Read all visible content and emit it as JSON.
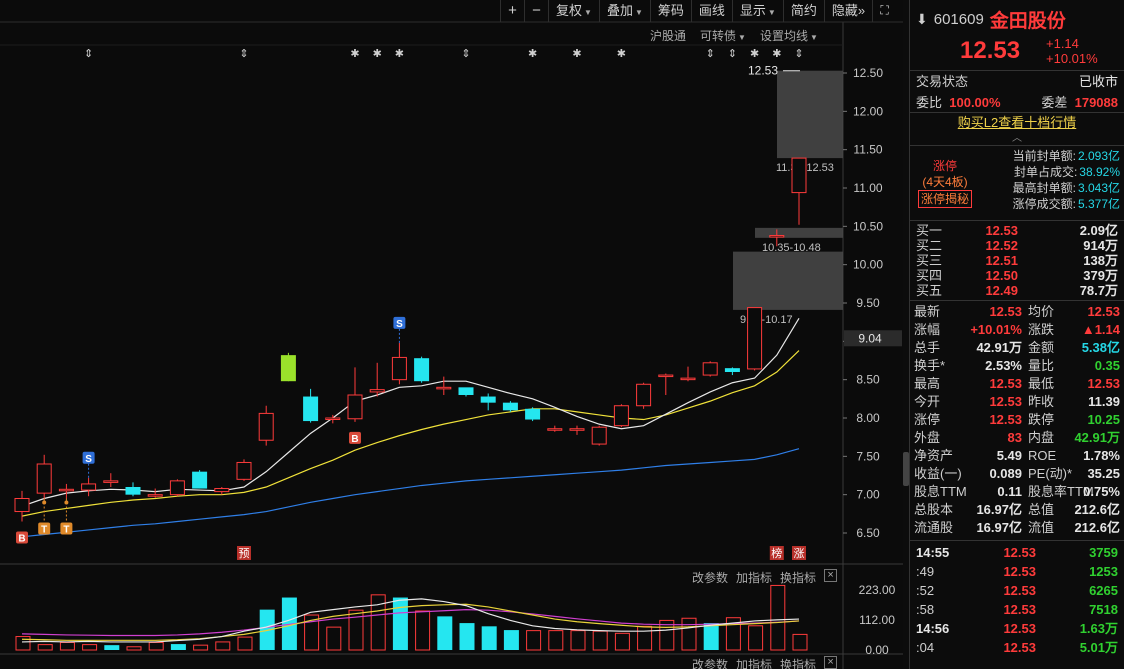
{
  "toolbar": {
    "plus": "+",
    "minus": "−",
    "items": [
      {
        "label": "复权",
        "caret": true
      },
      {
        "label": "叠加",
        "caret": true
      },
      {
        "label": "筹码",
        "caret": false
      },
      {
        "label": "画线",
        "caret": false
      },
      {
        "label": "显示",
        "caret": true
      },
      {
        "label": "简约",
        "caret": false
      },
      {
        "label": "隐藏",
        "caret": false
      }
    ],
    "hide_arrows": "»"
  },
  "subbar": {
    "hgt": "沪股通",
    "convertible": "可转债",
    "ma_setting": "设置均线"
  },
  "colors": {
    "up": "#ff3b3b",
    "down": "#25e6f0",
    "ma5": "#e8e8e8",
    "ma10": "#f0e23a",
    "ma30": "#2f7fe8",
    "vol_ma5": "#e8e8e8",
    "vol_ma10": "#e8d23a",
    "vol_ma20": "#d040d0"
  },
  "chart_data": {
    "type": "candlestick",
    "ylim": [
      6.3,
      12.75
    ],
    "y_ticks": [
      "12.50",
      "12.00",
      "11.50",
      "11.00",
      "10.50",
      "10.00",
      "9.50",
      "9.00",
      "8.50",
      "8.00",
      "7.50",
      "7.00",
      "6.50"
    ],
    "current_price_label": "9.04",
    "last_price_marker": "12.53",
    "candles": [
      {
        "o": 6.78,
        "h": 7.05,
        "l": 6.65,
        "c": 6.95
      },
      {
        "o": 7.02,
        "h": 7.52,
        "l": 6.95,
        "c": 7.4
      },
      {
        "o": 7.06,
        "h": 7.14,
        "l": 6.95,
        "c": 7.07
      },
      {
        "o": 7.06,
        "h": 7.22,
        "l": 6.98,
        "c": 7.14
      },
      {
        "o": 7.16,
        "h": 7.28,
        "l": 7.1,
        "c": 7.18
      },
      {
        "o": 7.1,
        "h": 7.16,
        "l": 6.98,
        "c": 7.0
      },
      {
        "o": 6.98,
        "h": 7.08,
        "l": 6.96,
        "c": 7.0
      },
      {
        "o": 7.0,
        "h": 7.2,
        "l": 6.98,
        "c": 7.18
      },
      {
        "o": 7.3,
        "h": 7.32,
        "l": 7.08,
        "c": 7.08
      },
      {
        "o": 7.04,
        "h": 7.1,
        "l": 7.0,
        "c": 7.08
      },
      {
        "o": 7.2,
        "h": 7.46,
        "l": 7.18,
        "c": 7.42
      },
      {
        "o": 7.71,
        "h": 8.16,
        "l": 7.64,
        "c": 8.06
      },
      {
        "o": 8.82,
        "h": 8.85,
        "l": 8.48,
        "c": 8.48
      },
      {
        "o": 8.28,
        "h": 8.38,
        "l": 7.94,
        "c": 7.96
      },
      {
        "o": 8.0,
        "h": 8.04,
        "l": 7.93,
        "c": 8.0
      },
      {
        "o": 7.99,
        "h": 8.66,
        "l": 7.95,
        "c": 8.3
      },
      {
        "o": 8.34,
        "h": 8.72,
        "l": 8.28,
        "c": 8.37
      },
      {
        "o": 8.5,
        "h": 8.98,
        "l": 8.44,
        "c": 8.79
      },
      {
        "o": 8.78,
        "h": 8.8,
        "l": 8.46,
        "c": 8.48
      },
      {
        "o": 8.38,
        "h": 8.54,
        "l": 8.3,
        "c": 8.4
      },
      {
        "o": 8.4,
        "h": 8.38,
        "l": 8.28,
        "c": 8.3
      },
      {
        "o": 8.28,
        "h": 8.32,
        "l": 8.1,
        "c": 8.2
      },
      {
        "o": 8.2,
        "h": 8.22,
        "l": 8.08,
        "c": 8.1
      },
      {
        "o": 8.12,
        "h": 8.14,
        "l": 7.96,
        "c": 7.98
      },
      {
        "o": 7.86,
        "h": 7.9,
        "l": 7.82,
        "c": 7.86
      },
      {
        "o": 7.84,
        "h": 7.9,
        "l": 7.78,
        "c": 7.86
      },
      {
        "o": 7.66,
        "h": 7.9,
        "l": 7.64,
        "c": 7.88
      },
      {
        "o": 7.9,
        "h": 8.18,
        "l": 7.88,
        "c": 8.16
      },
      {
        "o": 8.16,
        "h": 8.46,
        "l": 8.12,
        "c": 8.44
      },
      {
        "o": 8.56,
        "h": 8.58,
        "l": 8.3,
        "c": 8.56
      },
      {
        "o": 8.52,
        "h": 8.67,
        "l": 8.48,
        "c": 8.52
      },
      {
        "o": 8.56,
        "h": 8.74,
        "l": 8.54,
        "c": 8.72
      },
      {
        "o": 8.65,
        "h": 8.66,
        "l": 8.56,
        "c": 8.6
      },
      {
        "o": 8.64,
        "h": 9.44,
        "l": 8.62,
        "c": 9.44
      },
      {
        "o": 10.38,
        "h": 10.46,
        "l": 10.24,
        "c": 10.38
      },
      {
        "o": 10.94,
        "h": 11.39,
        "l": 10.52,
        "c": 11.39
      }
    ],
    "ma5": [
      6.85,
      6.95,
      7.02,
      7.05,
      7.07,
      7.06,
      7.04,
      7.07,
      7.06,
      7.05,
      7.1,
      7.3,
      7.55,
      7.8,
      8.0,
      8.22,
      8.3,
      8.4,
      8.42,
      8.48,
      8.48,
      8.4,
      8.32,
      8.25,
      8.14,
      8.02,
      7.92,
      7.86,
      7.9,
      8.05,
      8.2,
      8.34,
      8.46,
      8.52,
      8.82,
      9.3
    ],
    "ma10": [
      6.72,
      6.78,
      6.82,
      6.86,
      6.9,
      6.93,
      6.95,
      6.98,
      7.0,
      7.0,
      7.03,
      7.1,
      7.22,
      7.34,
      7.45,
      7.58,
      7.68,
      7.77,
      7.85,
      7.92,
      7.98,
      8.04,
      8.08,
      8.12,
      8.12,
      8.08,
      8.04,
      8.0,
      7.98,
      8.04,
      8.13,
      8.22,
      8.33,
      8.42,
      8.6,
      8.88
    ],
    "ma30": [
      6.45,
      6.48,
      6.51,
      6.54,
      6.57,
      6.6,
      6.62,
      6.65,
      6.68,
      6.71,
      6.74,
      6.78,
      6.84,
      6.9,
      6.95,
      7.0,
      7.04,
      7.08,
      7.12,
      7.15,
      7.18,
      7.2,
      7.22,
      7.24,
      7.26,
      7.28,
      7.3,
      7.32,
      7.35,
      7.38,
      7.4,
      7.42,
      7.44,
      7.46,
      7.52,
      7.6
    ],
    "chip_ranges": [
      {
        "from": 11.39,
        "to": 12.53,
        "label": "11.39-12.53"
      },
      {
        "from": 10.35,
        "to": 10.48,
        "label": "10.35-10.48"
      },
      {
        "from": 9.41,
        "to": 10.17,
        "label": "9.41-10.17"
      }
    ],
    "markers": [
      {
        "index": 0,
        "text": "B",
        "kind": "buy"
      },
      {
        "index": 1,
        "text": "T",
        "kind": "t"
      },
      {
        "index": 2,
        "text": "T",
        "kind": "t"
      },
      {
        "index": 3,
        "text": "S",
        "kind": "sell"
      },
      {
        "index": 15,
        "text": "B",
        "kind": "buy"
      },
      {
        "index": 17,
        "text": "S",
        "kind": "sell"
      }
    ],
    "bottom_tags": [
      {
        "index": 10,
        "text": "预"
      },
      {
        "index": 34,
        "text": "榜"
      },
      {
        "index": 35,
        "text": "涨"
      }
    ],
    "event_stars": [
      {
        "index": 3,
        "symbol": "⇕"
      },
      {
        "index": 10,
        "symbol": "⇕"
      },
      {
        "index": 15,
        "symbol": "✱"
      },
      {
        "index": 16,
        "symbol": "✱"
      },
      {
        "index": 17,
        "symbol": "✱"
      },
      {
        "index": 20,
        "symbol": "⇕"
      },
      {
        "index": 23,
        "symbol": "✱"
      },
      {
        "index": 25,
        "symbol": "✱"
      },
      {
        "index": 27,
        "symbol": "✱"
      },
      {
        "index": 31,
        "symbol": "⇕"
      },
      {
        "index": 32,
        "symbol": "⇕"
      },
      {
        "index": 33,
        "symbol": "✱"
      },
      {
        "index": 34,
        "symbol": "✱"
      },
      {
        "index": 35,
        "symbol": "⇕"
      }
    ],
    "volume": {
      "y_ticks": [
        "223.00",
        "112.00",
        "0.00"
      ],
      "ylim": [
        0,
        223
      ],
      "values": [
        18,
        50,
        20,
        28,
        20,
        18,
        12,
        28,
        22,
        18,
        30,
        48,
        150,
        195,
        130,
        85,
        148,
        205,
        195,
        145,
        125,
        100,
        88,
        74,
        72,
        72,
        72,
        70,
        62,
        88,
        110,
        118,
        100,
        120,
        90,
        240,
        58
      ],
      "ma5": [
        30,
        32,
        30,
        32,
        30,
        30,
        30,
        35,
        40,
        50,
        70,
        85,
        110,
        140,
        150,
        160,
        168,
        185,
        190,
        180,
        165,
        135,
        110,
        90,
        80,
        75,
        72,
        70,
        70,
        74,
        82,
        92,
        100,
        108,
        112,
        115
      ],
      "ma10": [
        40,
        38,
        36,
        36,
        36,
        36,
        36,
        38,
        42,
        50,
        58,
        72,
        90,
        110,
        125,
        135,
        145,
        158,
        165,
        168,
        170,
        160,
        145,
        130,
        115,
        105,
        98,
        92,
        86,
        84,
        86,
        90,
        94,
        98,
        102,
        108
      ],
      "ma20": [
        60,
        58,
        56,
        55,
        54,
        54,
        54,
        56,
        60,
        66,
        74,
        84,
        95,
        105,
        115,
        122,
        130,
        138,
        142,
        146,
        150,
        148,
        142,
        134,
        125,
        116,
        108,
        100,
        96,
        94,
        94,
        96,
        98,
        100,
        103,
        108
      ]
    }
  },
  "vol_tools": {
    "param": "改参数",
    "add": "加指标",
    "swap": "换指标",
    "close": "×"
  },
  "panel": {
    "code": "601609",
    "name": "金田股份",
    "price": "12.53",
    "change": "+1.14",
    "change_pct": "+10.01%",
    "status_label": "交易状态",
    "status_value": "已收市",
    "wb_label": "委比",
    "wb_value": "100.00%",
    "wc_label": "委差",
    "wc_value": "179088",
    "l2_link": "购买L2查看十档行情",
    "limit": {
      "tag": "涨停",
      "days": "(4天4板)",
      "secret": "涨停揭秘",
      "rows": [
        {
          "k": "当前封单额:",
          "v": "2.093亿"
        },
        {
          "k": "封单占成交:",
          "v": "38.92%"
        },
        {
          "k": "最高封单额:",
          "v": "3.043亿"
        },
        {
          "k": "涨停成交额:",
          "v": "5.377亿"
        }
      ]
    },
    "book": [
      {
        "label": "买一",
        "price": "12.53",
        "vol": "2.09亿"
      },
      {
        "label": "买二",
        "price": "12.52",
        "vol": "914万"
      },
      {
        "label": "买三",
        "price": "12.51",
        "vol": "138万"
      },
      {
        "label": "买四",
        "price": "12.50",
        "vol": "379万"
      },
      {
        "label": "买五",
        "price": "12.49",
        "vol": "78.7万"
      }
    ],
    "stats": [
      {
        "k1": "最新",
        "v1": "12.53",
        "c1": "red",
        "k2": "均价",
        "v2": "12.53",
        "c2": "red"
      },
      {
        "k1": "涨幅",
        "v1": "+10.01%",
        "c1": "red",
        "k2": "涨跌",
        "v2": "▲1.14",
        "c2": "red"
      },
      {
        "k1": "总手",
        "v1": "42.91万",
        "c1": "white",
        "k2": "金额",
        "v2": "5.38亿",
        "c2": "cyan"
      },
      {
        "k1": "换手*",
        "v1": "2.53%",
        "c1": "white",
        "k2": "量比",
        "v2": "0.35",
        "c2": "green"
      },
      {
        "k1": "最高",
        "v1": "12.53",
        "c1": "red",
        "k2": "最低",
        "v2": "12.53",
        "c2": "red"
      },
      {
        "k1": "今开",
        "v1": "12.53",
        "c1": "red",
        "k2": "昨收",
        "v2": "11.39",
        "c2": "white"
      },
      {
        "k1": "涨停",
        "v1": "12.53",
        "c1": "red",
        "k2": "跌停",
        "v2": "10.25",
        "c2": "green"
      },
      {
        "k1": "外盘",
        "v1": "83",
        "c1": "red",
        "k2": "内盘",
        "v2": "42.91万",
        "c2": "green"
      },
      {
        "k1": "净资产",
        "v1": "5.49",
        "c1": "white",
        "k2": "ROE",
        "v2": "1.78%",
        "c2": "white"
      },
      {
        "k1": "收益(一)",
        "v1": "0.089",
        "c1": "white",
        "k2": "PE(动)*",
        "v2": "35.25",
        "c2": "white"
      },
      {
        "k1": "股息TTM",
        "v1": "0.11",
        "c1": "white",
        "k2": "股息率TTM",
        "v2": "0.75%",
        "c2": "white"
      },
      {
        "k1": "总股本",
        "v1": "16.97亿",
        "c1": "white",
        "k2": "总值",
        "v2": "212.6亿",
        "c2": "white"
      },
      {
        "k1": "流通股",
        "v1": "16.97亿",
        "c1": "white",
        "k2": "流值",
        "v2": "212.6亿",
        "c2": "white"
      }
    ],
    "ticks": [
      {
        "t": "14:55",
        "p": "12.53",
        "q": "3759",
        "bold": true
      },
      {
        "t": ":49",
        "p": "12.53",
        "q": "1253",
        "bold": false
      },
      {
        "t": ":52",
        "p": "12.53",
        "q": "6265",
        "bold": false
      },
      {
        "t": ":58",
        "p": "12.53",
        "q": "7518",
        "bold": false
      },
      {
        "t": "14:56",
        "p": "12.53",
        "q": "1.63万",
        "bold": true
      },
      {
        "t": ":04",
        "p": "12.53",
        "q": "5.01万",
        "bold": false
      }
    ]
  }
}
